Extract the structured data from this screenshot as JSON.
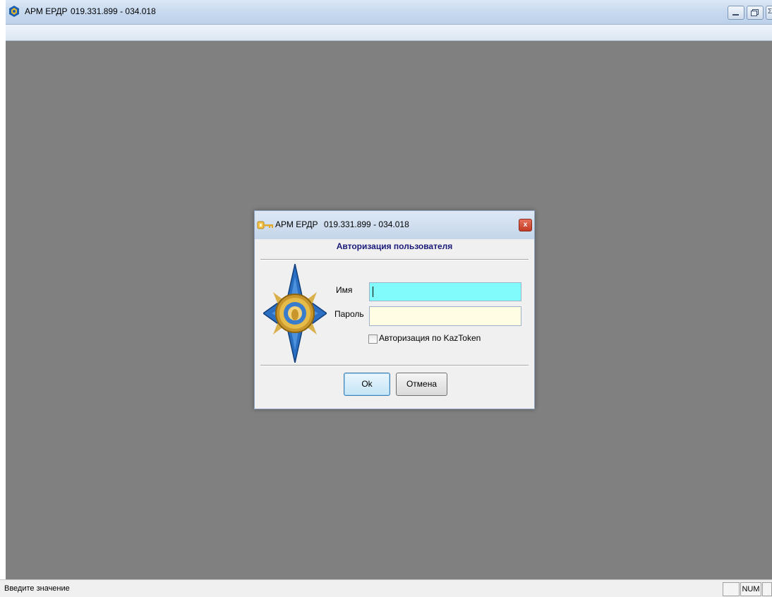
{
  "window": {
    "title": "АРМ ЕРДР",
    "version": "019.331.899 - 034.018",
    "buttons": [
      "minimize-button",
      "restore-button",
      "close-button"
    ]
  },
  "dialog": {
    "title": "АРМ ЕРДР",
    "version": "019.331.899 - 034.018",
    "close_label": "x",
    "heading": "Авторизация пользователя",
    "name_label": "Имя",
    "name_value": "",
    "password_label": "Пароль",
    "password_value": "",
    "kaztoken_label": "Авторизация по KazToken",
    "kaztoken_checked": false,
    "ok_label": "Ok",
    "cancel_label": "Отмена"
  },
  "statusbar": {
    "text": "Введите значение",
    "num_indicator": "NUM"
  },
  "colors": {
    "workspace": "#808080",
    "name_field_bg": "#82fbfd",
    "password_field_bg": "#fffde2",
    "heading_text": "#1a1a7a"
  },
  "icons": {
    "app": "kazakhstan-emblem-icon",
    "dialog": "key-icon",
    "logo": "prosecutor-star-emblem"
  }
}
